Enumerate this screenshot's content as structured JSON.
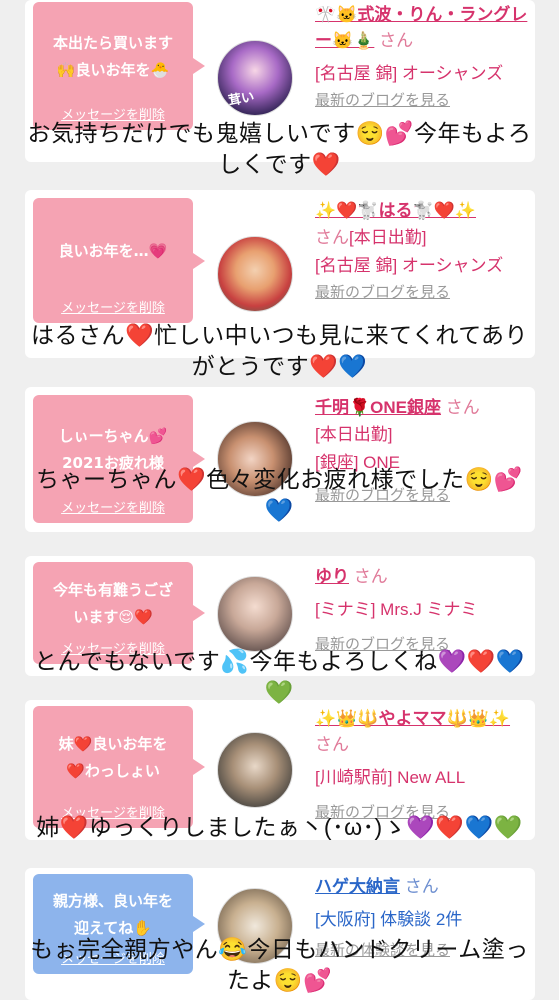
{
  "cards": [
    {
      "message": [
        "本出たら買います",
        "🙌良いお年を🐣"
      ],
      "delete_label": "メッセージを削除",
      "name": "🎌🐱式波・りん・ラングレー🐱🎍",
      "san": "さん",
      "shop": "[名古屋 錦] オーシャンズ",
      "blog_link": "最新のブログを見る",
      "avatar_text": "茸い"
    },
    {
      "message": [
        "良いお年を…💗"
      ],
      "delete_label": "メッセージを削除",
      "name": "✨❤️🐩はる🐩❤️✨",
      "san": "さん",
      "status": "[本日出勤]",
      "shop": "[名古屋 錦] オーシャンズ",
      "blog_link": "最新のブログを見る"
    },
    {
      "message": [
        "しぃーちゃん💕",
        "2021お疲れ様"
      ],
      "delete_label": "メッセージを削除",
      "name": "千明🌹ONE銀座",
      "san": "さん",
      "status": "[本日出勤]",
      "shop": "[銀座] ONE",
      "blog_link": "最新のブログを見る"
    },
    {
      "message": [
        "今年も有難うござ",
        "います😌❤️"
      ],
      "delete_label": "メッセージを削除",
      "name": "ゆり",
      "san": "さん",
      "shop": "[ミナミ] Mrs.J ミナミ",
      "blog_link": "最新のブログを見る"
    },
    {
      "message": [
        "妹❤️良いお年を",
        "❤️わっしょい"
      ],
      "delete_label": "メッセージを削除",
      "name": "✨👑🔱やよママ🔱👑✨",
      "san": "さん",
      "shop": "[川崎駅前] New ALL",
      "blog_link": "最新のブログを見る"
    },
    {
      "message": [
        "親方様、良い年を",
        "迎えてね✋"
      ],
      "delete_label": "メッセージを削除",
      "name": "ハゲ大納言",
      "san": "さん",
      "shop": "[大阪府] 体験談 2件",
      "blog_link": "最新の体験談を見る"
    }
  ],
  "captions": [
    [
      "お気持ちだけでも鬼嬉しいです😌💕今年もよろ",
      "しくです❤️"
    ],
    [
      "はるさん❤️忙しい中いつも見に来てくれてあり",
      "がとうです❤️💙"
    ],
    [
      "ちゃーちゃん❤️色々変化お疲れ様でした😌💕",
      "💙"
    ],
    [
      "とんでもないです💦今年もよろしくね💜❤️💙",
      "💚"
    ],
    [
      "姉❤️ゆっくりしましたぁ丶(･ω･)ゝ💜❤️💙💚"
    ],
    [
      "もぉ完全親方やん😂今日もハンドクリーム塗っ",
      "たよ😌💕"
    ]
  ],
  "colors": {
    "pink_bubble": "#f5a3b3",
    "blue_bubble": "#8db4ec",
    "name_pink": "#d6336c",
    "name_blue": "#2a66c8"
  }
}
